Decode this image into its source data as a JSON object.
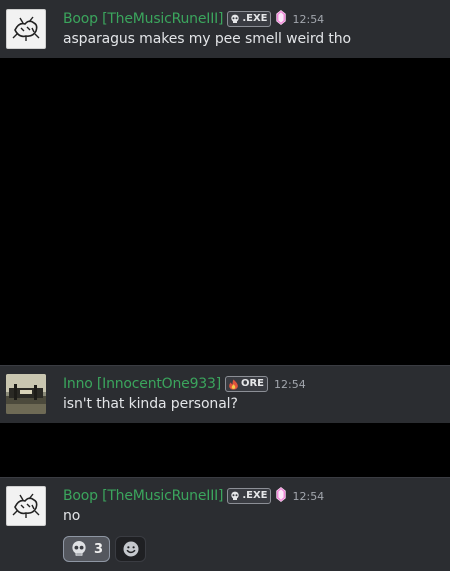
{
  "messages": [
    {
      "username": "Boop [TheMusicRuneIII]",
      "tag_label": ".EXE",
      "tag_icon": "skull-icon",
      "extra_icon": "pink-gem-icon",
      "timestamp": "12:54",
      "text": "asparagus makes my pee smell weird tho"
    },
    {
      "username": "Inno [InnocentOne933]",
      "tag_label": "ORE",
      "tag_icon": "fire-icon",
      "timestamp": "12:54",
      "text": "isn't that kinda personal?"
    },
    {
      "username": "Boop [TheMusicRuneIII]",
      "tag_label": ".EXE",
      "tag_icon": "skull-icon",
      "extra_icon": "pink-gem-icon",
      "timestamp": "12:54",
      "text": "no",
      "reactions": [
        {
          "emoji": "skull-icon",
          "count": "3"
        }
      ]
    }
  ],
  "colors": {
    "username": "#3ba55d",
    "message_bg": "#2b2d31",
    "gap_bg": "#000000",
    "text": "#e3e5e8",
    "timestamp": "#a2a6ad"
  }
}
